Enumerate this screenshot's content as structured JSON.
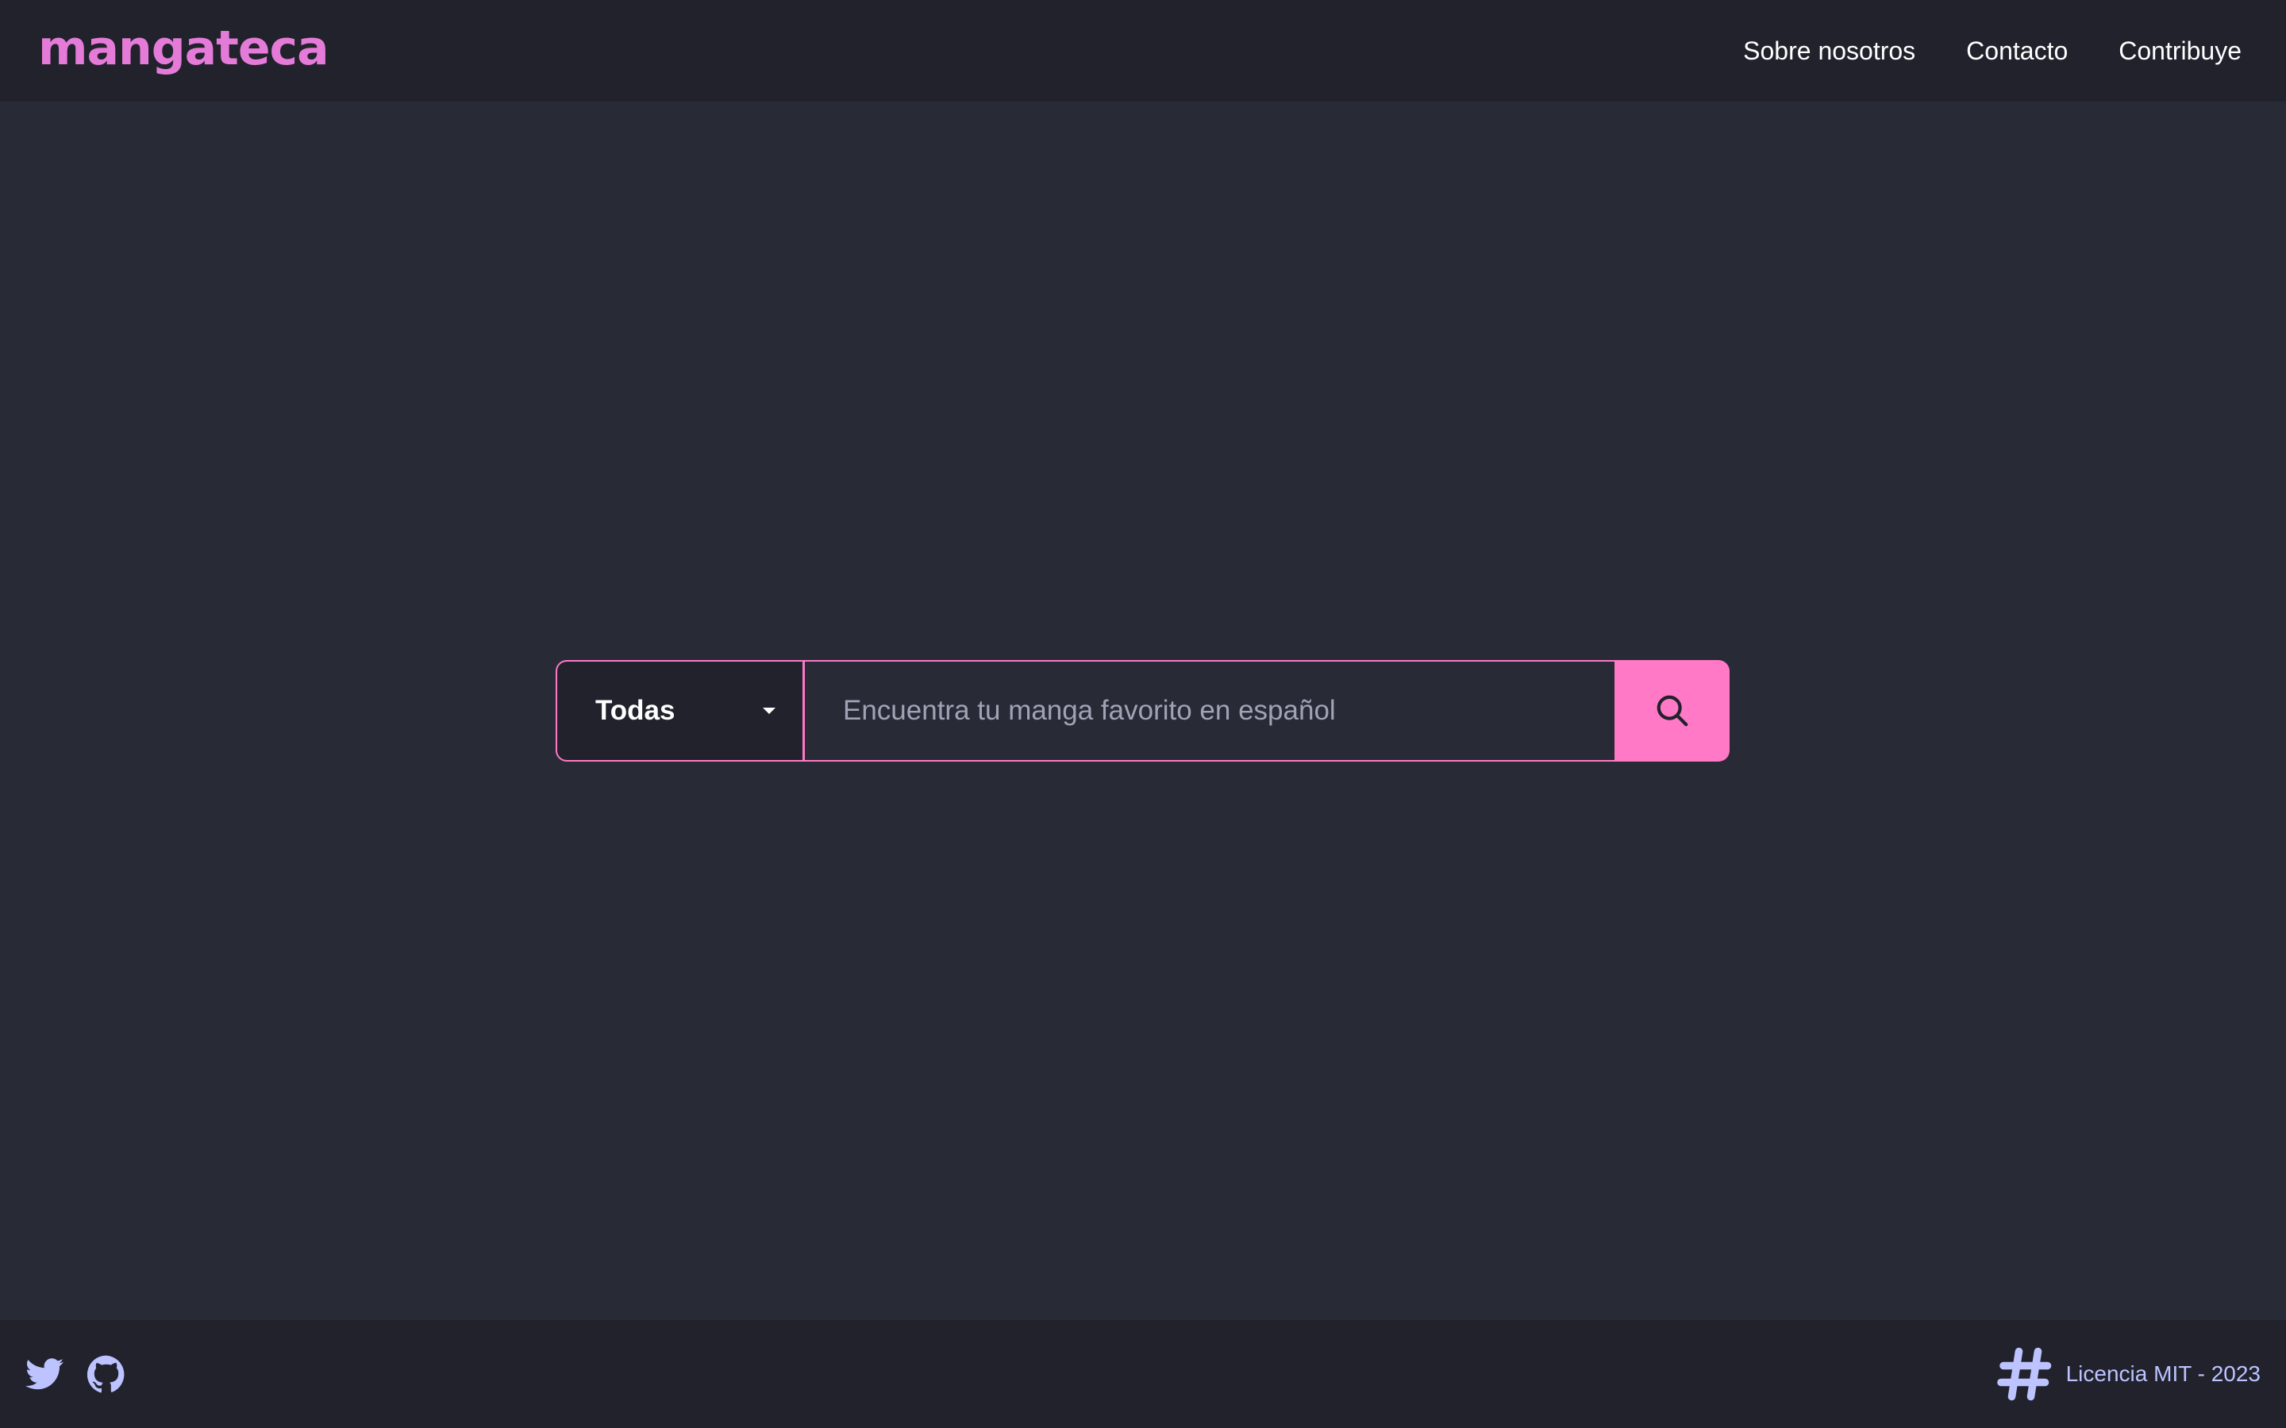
{
  "header": {
    "logo": "mangateca",
    "nav": [
      {
        "label": "Sobre nosotros"
      },
      {
        "label": "Contacto"
      },
      {
        "label": "Contribuye"
      }
    ]
  },
  "search": {
    "category": {
      "selected": "Todas",
      "icon": "caret-down-icon"
    },
    "input": {
      "value": "",
      "placeholder": "Encuentra tu manga favorito en español"
    },
    "button_icon": "search-icon"
  },
  "footer": {
    "social_icons": [
      "twitter-icon",
      "github-icon"
    ],
    "license_icon": "hashtag-icon",
    "license_text": "Licencia MIT - 2023"
  },
  "colors": {
    "background": "#282a36",
    "bars": "#21222c",
    "accent": "#ff79c6",
    "logo": "#e57bd8",
    "footer_icons": "#bcc3ff"
  }
}
